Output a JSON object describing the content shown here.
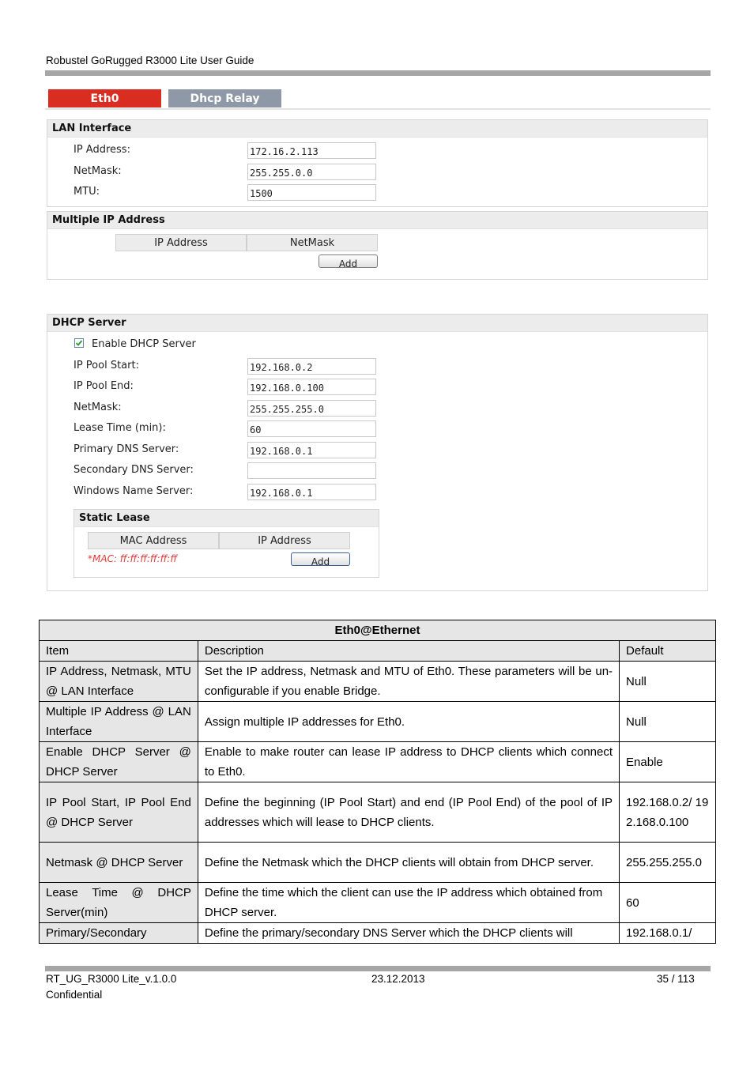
{
  "document": {
    "header_title": "Robustel GoRugged R3000 Lite User Guide",
    "footer": {
      "doc_id": "RT_UG_R3000 Lite_v.1.0.0",
      "date": "23.12.2013",
      "page": "35 / 113",
      "classification": "Confidential"
    }
  },
  "tabs": [
    {
      "label": "Eth0",
      "active": true,
      "color": "#d92d22"
    },
    {
      "label": "Dhcp Relay",
      "active": false,
      "color": "#8e98a6"
    }
  ],
  "lan_interface": {
    "title": "LAN Interface",
    "fields": [
      {
        "label": "IP Address:",
        "value": "172.16.2.113"
      },
      {
        "label": "NetMask:",
        "value": "255.255.0.0"
      },
      {
        "label": "MTU:",
        "value": "1500"
      }
    ]
  },
  "multiple_ip": {
    "title": "Multiple IP Address",
    "columns": [
      "IP Address",
      "NetMask"
    ],
    "add_label": "Add"
  },
  "dhcp_server": {
    "title": "DHCP Server",
    "enable_label": "Enable DHCP Server",
    "enable_checked": true,
    "fields": [
      {
        "label": "IP Pool Start:",
        "value": "192.168.0.2"
      },
      {
        "label": "IP Pool End:",
        "value": "192.168.0.100"
      },
      {
        "label": "NetMask:",
        "value": "255.255.255.0"
      },
      {
        "label": "Lease Time (min):",
        "value": "60"
      },
      {
        "label": "Primary DNS Server:",
        "value": "192.168.0.1"
      },
      {
        "label": "Secondary DNS Server:",
        "value": ""
      },
      {
        "label": "Windows Name Server:",
        "value": "192.168.0.1"
      }
    ],
    "static_lease": {
      "title": "Static Lease",
      "columns": [
        "MAC Address",
        "IP Address"
      ],
      "hint": "*MAC: ff:ff:ff:ff:ff:ff",
      "add_label": "Add"
    }
  },
  "spec_table": {
    "title": "Eth0@Ethernet",
    "headers": [
      "Item",
      "Description",
      "Default"
    ],
    "rows": [
      {
        "item": "IP Address, Netmask, MTU @ LAN Interface",
        "description": "Set the IP address, Netmask and MTU of Eth0. These parameters will be un-configurable if you enable Bridge.",
        "default": "Null"
      },
      {
        "item": "Multiple IP Address @ LAN Interface",
        "description": "Assign multiple IP addresses for Eth0.",
        "default": "Null"
      },
      {
        "item": "Enable DHCP Server @ DHCP Server",
        "description": "Enable to make router can lease IP address to DHCP clients which connect to Eth0.",
        "default": "Enable"
      },
      {
        "item": "IP Pool Start, IP Pool End @ DHCP Server",
        "description": "Define the beginning (IP Pool Start) and end (IP Pool End) of the pool of IP addresses which will lease to DHCP clients.",
        "default": "192.168.0.2/ 192.168.0.100"
      },
      {
        "item": "Netmask @ DHCP Server",
        "description": "Define the Netmask which the DHCP clients will obtain from DHCP server.",
        "default": "255.255.255.0"
      },
      {
        "item": "Lease Time @ DHCP Server(min)",
        "description": "Define the time which the client can use the IP address which obtained from DHCP server.",
        "default": "60"
      },
      {
        "item": "Primary/Secondary",
        "description": "Define the primary/secondary DNS Server which the DHCP clients will",
        "default": "192.168.0.1/"
      }
    ]
  }
}
